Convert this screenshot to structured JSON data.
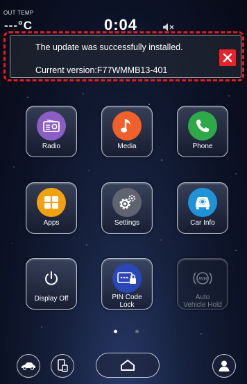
{
  "status_bar": {
    "out_temp_label": "OUT TEMP",
    "out_temp_value": "---°C",
    "clock": "0:04",
    "mute_icon": "speaker-muted-icon"
  },
  "notification": {
    "message": "The update was successfully installed.",
    "version": "Current version:F77WMMB13-401",
    "close_icon": "close-icon",
    "close_color": "#e8212a",
    "highlight_color": "#e81a1a"
  },
  "apps": [
    {
      "label": "Radio",
      "icon": "radio-icon",
      "color": "#8a5ec4",
      "enabled": true
    },
    {
      "label": "Media",
      "icon": "music-note-icon",
      "color": "#f0602a",
      "enabled": true
    },
    {
      "label": "Phone",
      "icon": "phone-icon",
      "color": "#2fa84a",
      "enabled": true
    },
    {
      "label": "Apps",
      "icon": "apps-grid-icon",
      "color": "#f2a10f",
      "enabled": true
    },
    {
      "label": "Settings",
      "icon": "gear-icon",
      "color": "#5f6470",
      "enabled": true
    },
    {
      "label": "Car Info",
      "icon": "car-info-icon",
      "color": "#1f93d8",
      "enabled": true
    },
    {
      "label": "Display Off",
      "icon": "power-icon",
      "color": "none",
      "enabled": true
    },
    {
      "label_line1": "PIN Code",
      "label_line2": "Lock",
      "icon": "pin-card-lock-icon",
      "color": "#2a47b8",
      "enabled": true
    },
    {
      "label_line1": "Auto",
      "label_line2": "Vehicle Hold",
      "icon": "avh-icon",
      "color": "none",
      "enabled": false
    }
  ],
  "pagination": {
    "current_page": 1,
    "total_pages": 2
  },
  "bottom_bar": {
    "car_icon": "car-icon",
    "phone_projection_icon": "phone-projection-icon",
    "home_icon": "home-icon",
    "profile_icon": "profile-icon"
  }
}
